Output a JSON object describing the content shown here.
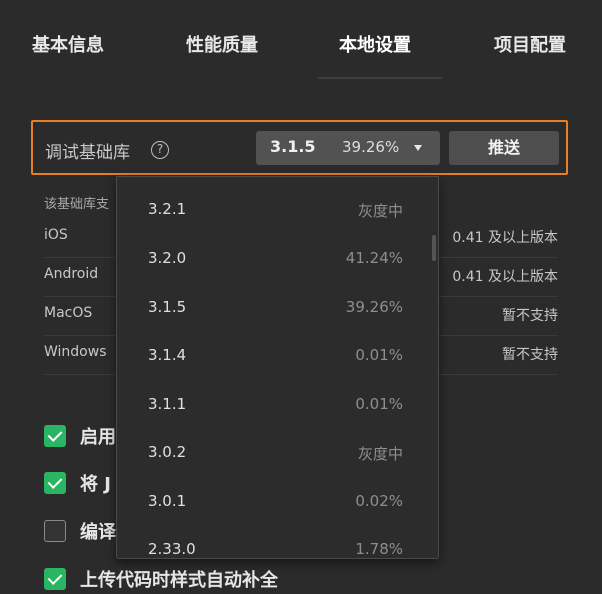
{
  "tabs": [
    {
      "label": "基本信息"
    },
    {
      "label": "性能质量"
    },
    {
      "label": "本地设置"
    },
    {
      "label": "项目配置"
    }
  ],
  "debug_library": {
    "label": "调试基础库",
    "help_symbol": "?",
    "selected_version": "3.1.5",
    "selected_percent": "39.26%",
    "push_label": "推送"
  },
  "support": {
    "title": "该基础库支",
    "platforms": [
      {
        "name": "iOS",
        "value": "0.41 及以上版本"
      },
      {
        "name": "Android",
        "value": "0.41 及以上版本"
      },
      {
        "name": "MacOS",
        "value": "暂不支持"
      },
      {
        "name": "Windows",
        "value": "暂不支持"
      }
    ]
  },
  "checks": [
    {
      "label": "启用",
      "checked": true
    },
    {
      "label": "将 J",
      "checked": true
    },
    {
      "label": "编译",
      "checked": false
    },
    {
      "label": "上传代码时样式自动补全",
      "checked": true
    }
  ],
  "version_dropdown": [
    {
      "version": "3.2.1",
      "percent": "灰度中"
    },
    {
      "version": "3.2.0",
      "percent": "41.24%"
    },
    {
      "version": "3.1.5",
      "percent": "39.26%"
    },
    {
      "version": "3.1.4",
      "percent": "0.01%"
    },
    {
      "version": "3.1.1",
      "percent": "0.01%"
    },
    {
      "version": "3.0.2",
      "percent": "灰度中"
    },
    {
      "version": "3.0.1",
      "percent": "0.02%"
    },
    {
      "version": "2.33.0",
      "percent": "1.78%"
    }
  ],
  "colors": {
    "highlight_border": "#e77f24",
    "checkbox_on": "#2ab564"
  }
}
